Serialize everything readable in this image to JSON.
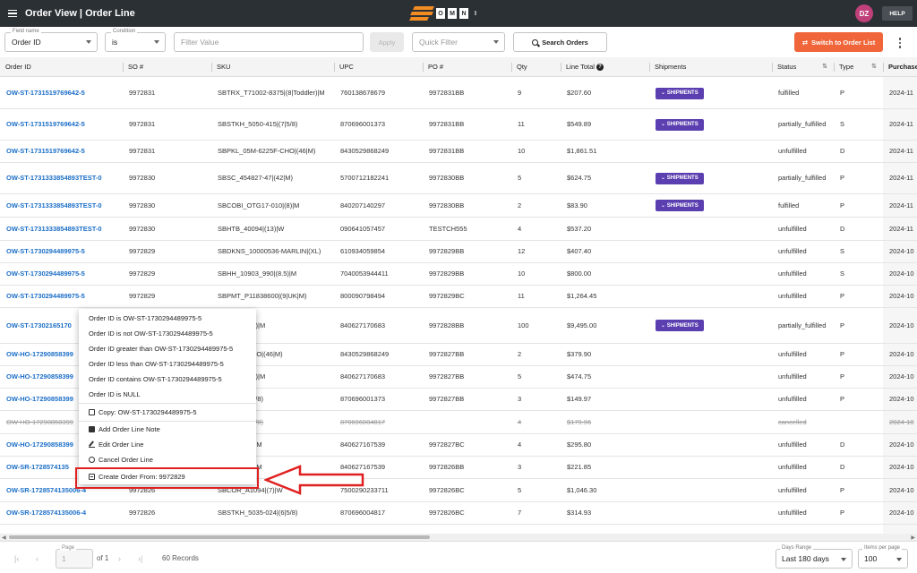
{
  "header": {
    "title": "Order View | Order Line",
    "logo_text": [
      "O",
      "M",
      "N",
      "I"
    ],
    "avatar_initials": "DZ",
    "help_label": "HELP"
  },
  "filters": {
    "field_label": "Field name",
    "field_value": "Order ID",
    "condition_label": "Condition",
    "condition_value": "is",
    "value_placeholder": "Filter Value",
    "apply_label": "Apply",
    "quick_filter_placeholder": "Quick Filter",
    "search_label": "Search Orders",
    "switch_label": "Switch to Order List"
  },
  "table": {
    "headers": {
      "order_id": "Order ID",
      "so": "SO #",
      "sku": "SKU",
      "upc": "UPC",
      "po": "PO #",
      "qty": "Qty",
      "line_total": "Line Total",
      "shipments": "Shipments",
      "status": "Status",
      "type": "Type",
      "purchase": "Purchase"
    },
    "shipments_label": "SHIPMENTS",
    "rows": [
      {
        "order_id": "OW-ST-1731519769642-5",
        "so": "9972831",
        "sku": "SBTRX_T71002-8375|(8|Toddler)|M",
        "upc": "760138678679",
        "po": "9972831BB",
        "qty": "9",
        "total": "$207.60",
        "ship": true,
        "status": "fulfilled",
        "type": "P",
        "purchase": "2024-11"
      },
      {
        "order_id": "OW-ST-1731519769642-5",
        "so": "9972831",
        "sku": "SBSTKH_5050-415|(7|5/8)",
        "upc": "870696001373",
        "po": "9972831BB",
        "qty": "11",
        "total": "$549.89",
        "ship": true,
        "status": "partially_fulfilled",
        "type": "S",
        "purchase": "2024-11"
      },
      {
        "order_id": "OW-ST-1731519769642-5",
        "so": "9972831",
        "sku": "SBPKL_05M-6225F-CHO|(46|M)",
        "upc": "8430529868249",
        "po": "9972831BB",
        "qty": "10",
        "total": "$1,861.51",
        "ship": false,
        "status": "unfulfilled",
        "type": "D",
        "purchase": "2024-11"
      },
      {
        "order_id": "OW-ST-1731333854893TEST-0",
        "so": "9972830",
        "sku": "SBSC_454827-47|(42|M)",
        "upc": "5700712182241",
        "po": "9972830BB",
        "qty": "5",
        "total": "$624.75",
        "ship": true,
        "status": "partially_fulfilled",
        "type": "P",
        "purchase": "2024-11"
      },
      {
        "order_id": "OW-ST-1731333854893TEST-0",
        "so": "9972830",
        "sku": "SBCOBI_OTG17-010|(8)|M",
        "upc": "840207140297",
        "po": "9972830BB",
        "qty": "2",
        "total": "$83.90",
        "ship": true,
        "status": "fulfilled",
        "type": "P",
        "purchase": "2024-11"
      },
      {
        "order_id": "OW-ST-1731333854893TEST-0",
        "so": "9972830",
        "sku": "SBHTB_40094|(13)|W",
        "upc": "090641057457",
        "po": "TESTCH555",
        "qty": "4",
        "total": "$537.20",
        "ship": false,
        "status": "unfulfilled",
        "type": "D",
        "purchase": "2024-11"
      },
      {
        "order_id": "OW-ST-1730294489975-5",
        "so": "9972829",
        "sku": "SBDKNS_10000536-MARLIN|(XL)",
        "upc": "610934059854",
        "po": "9972829BB",
        "qty": "12",
        "total": "$407.40",
        "ship": false,
        "status": "unfulfilled",
        "type": "S",
        "purchase": "2024-10"
      },
      {
        "order_id": "OW-ST-1730294489975-5",
        "so": "9972829",
        "sku": "SBHH_10903_990|(8.5)|M",
        "upc": "7040053944411",
        "po": "9972829BB",
        "qty": "10",
        "total": "$800.00",
        "ship": false,
        "status": "unfulfilled",
        "type": "S",
        "purchase": "2024-10"
      },
      {
        "order_id": "OW-ST-1730294489975-5",
        "so": "9972829",
        "sku": "SBPMT_P11838600|(9|UK|M)",
        "upc": "800090798494",
        "po": "9972829BC",
        "qty": "11",
        "total": "$1,264.45",
        "ship": false,
        "status": "unfulfilled",
        "type": "P",
        "purchase": "2024-10"
      },
      {
        "order_id": "OW-ST-17302165170",
        "so": "",
        "sku": "08W-274|(11)|M",
        "upc": "840627170683",
        "po": "9972828BB",
        "qty": "100",
        "total": "$9,495.00",
        "ship": true,
        "status": "partially_fulfilled",
        "type": "P",
        "purchase": "2024-10"
      },
      {
        "order_id": "OW-HO-17290858399",
        "so": "",
        "sku": "M-6225F-CHO|(46|M)",
        "upc": "8430529868249",
        "po": "9972827BB",
        "qty": "2",
        "total": "$379.90",
        "ship": false,
        "status": "unfulfilled",
        "type": "P",
        "purchase": "2024-10"
      },
      {
        "order_id": "OW-HO-17290858399",
        "so": "",
        "sku": "08W-274|(11)|M",
        "upc": "840627170683",
        "po": "9972827BB",
        "qty": "5",
        "total": "$474.75",
        "ship": false,
        "status": "unfulfilled",
        "type": "P",
        "purchase": "2024-10"
      },
      {
        "order_id": "OW-HO-17290858399",
        "so": "",
        "sku": "050-415|(7|5/8)",
        "upc": "870696001373",
        "po": "9972827BB",
        "qty": "3",
        "total": "$149.97",
        "ship": false,
        "status": "unfulfilled",
        "type": "P",
        "purchase": "2024-10"
      },
      {
        "order_id": "OW-HO-17290858399",
        "so": "",
        "sku": "035-024|(6|5/8)",
        "upc": "870696004817",
        "po": "",
        "qty": "4",
        "total": "$179.96",
        "ship": false,
        "status": "cancelled",
        "type": "",
        "purchase": "2024-10",
        "cancel": true
      },
      {
        "order_id": "OW-HO-17290858399",
        "so": "",
        "sku": "0W-663|(12)|M",
        "upc": "840627167539",
        "po": "9972827BC",
        "qty": "4",
        "total": "$295.80",
        "ship": false,
        "status": "unfulfilled",
        "type": "D",
        "purchase": "2024-10"
      },
      {
        "order_id": "OW-SR-1728574135",
        "so": "",
        "sku": "0W-663|(12)|M",
        "upc": "840627167539",
        "po": "9972826BB",
        "qty": "3",
        "total": "$221.85",
        "ship": false,
        "status": "unfulfilled",
        "type": "D",
        "purchase": "2024-10"
      },
      {
        "order_id": "OW-SR-1728574135006-4",
        "so": "9972826",
        "sku": "SBCOR_A1094|(7)|W",
        "upc": "7500290233711",
        "po": "9972826BC",
        "qty": "5",
        "total": "$1,046.30",
        "ship": false,
        "status": "unfulfilled",
        "type": "P",
        "purchase": "2024-10"
      },
      {
        "order_id": "OW-SR-1728574135006-4",
        "so": "9972826",
        "sku": "SBSTKH_5035-024|(6|5/8)",
        "upc": "870696004817",
        "po": "9972826BC",
        "qty": "7",
        "total": "$314.93",
        "ship": false,
        "status": "unfulfilled",
        "type": "P",
        "purchase": "2024-10"
      }
    ]
  },
  "context_menu": {
    "items": [
      "Order ID is OW-ST-1730294489975-5",
      "Order ID is not OW-ST-1730294489975-5",
      "Order ID greater than OW-ST-1730294489975-5",
      "Order ID less than OW-ST-1730294489975-5",
      "Order ID contains OW-ST-1730294489975-5",
      "Order ID is NULL"
    ],
    "copy": "Copy: OW-ST-1730294489975-5",
    "add_note": "Add Order Line Note",
    "edit": "Edit Order Line",
    "cancel": "Cancel Order Line",
    "create": "Create Order From: 9972829"
  },
  "footer": {
    "page_label": "Page",
    "page_value": "1",
    "of_text": "of 1",
    "records": "60 Records",
    "days_label": "Days Range",
    "days_value": "Last 180 days",
    "per_page_label": "Items per page",
    "per_page_value": "100"
  },
  "colors": {
    "topbar": "#2b3035",
    "accent_orange": "#f0663a",
    "link_blue": "#1c6fc7",
    "shipments_purple": "#5b3fb0",
    "highlight_red": "#e02020"
  }
}
